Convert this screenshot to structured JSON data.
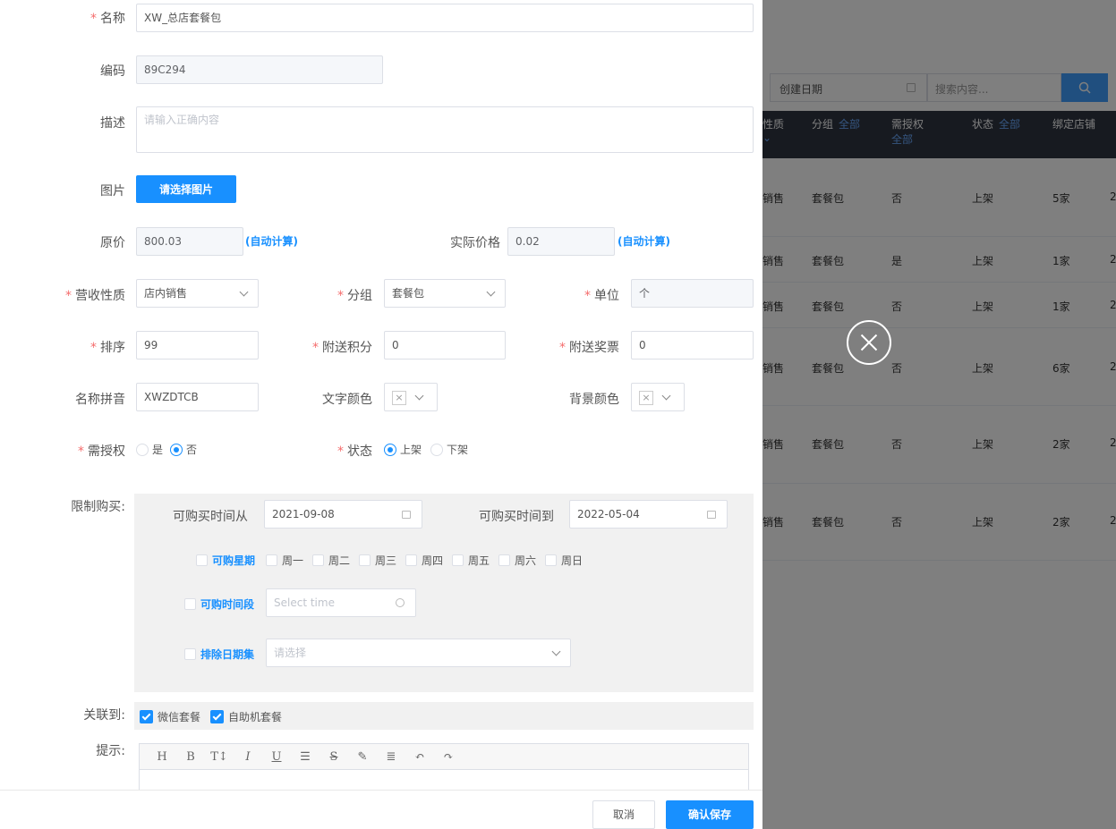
{
  "background": {
    "date_placeholder": "创建日期",
    "search_placeholder": "搜索内容...",
    "columns": [
      "性质",
      "分组",
      "全部",
      "需授权",
      "全部",
      "状态",
      "全部",
      "绑定店铺"
    ],
    "rows": [
      {
        "nature": "销售",
        "group": "套餐包",
        "auth": "否",
        "status": "上架",
        "shops": "5家"
      },
      {
        "nature": "销售",
        "group": "套餐包",
        "auth": "是",
        "status": "上架",
        "shops": "1家"
      },
      {
        "nature": "销售",
        "group": "套餐包",
        "auth": "否",
        "status": "上架",
        "shops": "1家"
      },
      {
        "nature": "销售",
        "group": "套餐包",
        "auth": "否",
        "status": "上架",
        "shops": "6家"
      },
      {
        "nature": "销售",
        "group": "套餐包",
        "auth": "否",
        "status": "上架",
        "shops": "2家"
      },
      {
        "nature": "销售",
        "group": "套餐包",
        "auth": "否",
        "status": "上架",
        "shops": "2家"
      }
    ],
    "trailing_digit": "2"
  },
  "form": {
    "name_label": "名称",
    "name_value": "XW_总店套餐包",
    "code_label": "编码",
    "code_value": "89C294",
    "desc_label": "描述",
    "desc_placeholder": "请输入正确内容",
    "image_label": "图片",
    "image_button": "请选择图片",
    "orig_price_label": "原价",
    "orig_price_value": "800.03",
    "auto_calc": "(自动计算)",
    "actual_price_label": "实际价格",
    "actual_price_value": "0.02",
    "revenue_type_label": "营收性质",
    "revenue_type_value": "店内销售",
    "group_label": "分组",
    "group_value": "套餐包",
    "unit_label": "单位",
    "unit_value": "个",
    "sort_label": "排序",
    "sort_value": "99",
    "points_label": "附送积分",
    "points_value": "0",
    "voucher_label": "附送奖票",
    "voucher_value": "0",
    "pinyin_label": "名称拼音",
    "pinyin_value": "XWZDTCB",
    "text_color_label": "文字颜色",
    "bg_color_label": "背景颜色",
    "need_auth_label": "需授权",
    "yes": "是",
    "no": "否",
    "status_label": "状态",
    "on_shelf": "上架",
    "off_shelf": "下架",
    "limit_label": "限制购买:",
    "time_from_label": "可购买时间从",
    "time_from_value": "2021-09-08",
    "time_to_label": "可购买时间到",
    "time_to_value": "2022-05-04",
    "weekday_toggle": "可购星期",
    "weekdays": [
      "周一",
      "周二",
      "周三",
      "周四",
      "周五",
      "周六",
      "周日"
    ],
    "time_range_toggle": "可购时间段",
    "time_placeholder": "Select time",
    "exclude_toggle": "排除日期集",
    "exclude_placeholder": "请选择",
    "relate_label": "关联到:",
    "relate_wechat": "微信套餐",
    "relate_kiosk": "自助机套餐",
    "tip_label": "提示:",
    "editor_tools": [
      "H",
      "B",
      "T↕",
      "I",
      "U",
      "☰",
      "S",
      "✎",
      "≣",
      "↶",
      "↷"
    ]
  },
  "footer": {
    "cancel": "取消",
    "save": "确认保存"
  },
  "colors": {
    "primary": "#1890ff",
    "required": "#f56c6c",
    "table_header": "#2f3541"
  }
}
